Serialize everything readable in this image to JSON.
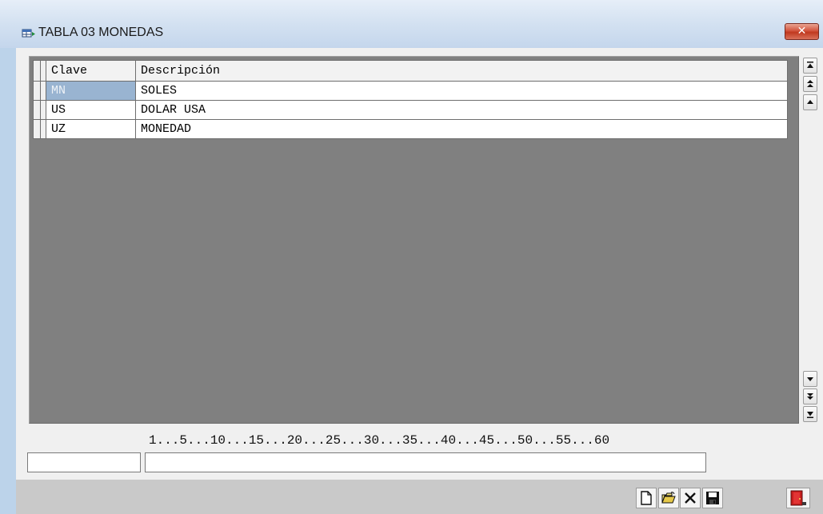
{
  "window": {
    "title": "TABLA 03 MONEDAS",
    "close_glyph": "✕",
    "icon": "table-window-icon"
  },
  "grid": {
    "columns": [
      "Clave",
      "Descripción"
    ],
    "rows": [
      {
        "clave": "MN",
        "descripcion": "SOLES",
        "selected": true
      },
      {
        "clave": "US",
        "descripcion": "DOLAR USA",
        "selected": false
      },
      {
        "clave": "UZ",
        "descripcion": "MONEDAD",
        "selected": false
      }
    ]
  },
  "scrollbar": {
    "icons": [
      "scroll-top-icon",
      "scroll-page-up-icon",
      "scroll-up-icon",
      "scroll-down-icon",
      "scroll-page-down-icon",
      "scroll-bottom-icon"
    ]
  },
  "ruler": "1...5...10...15...20...25...30...35...40...45...50...55...60",
  "fields": {
    "clave_value": "",
    "descripcion_value": ""
  },
  "toolbar": {
    "icons": [
      "new-document-icon",
      "open-folder-icon",
      "delete-icon",
      "save-icon",
      "exit-door-icon"
    ]
  },
  "colors": {
    "selection": "#99b4d1",
    "grid_background": "#808080",
    "close_button": "#c0391f"
  }
}
